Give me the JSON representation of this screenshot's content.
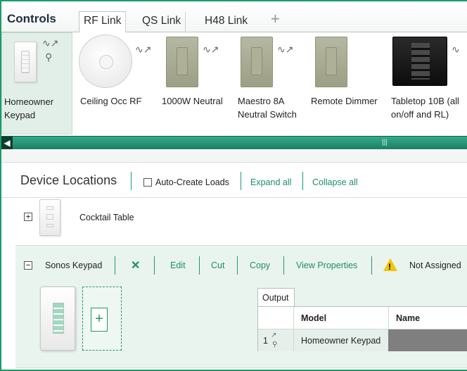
{
  "tabs": {
    "controls_label": "Controls",
    "items": [
      {
        "label": "RF Link"
      },
      {
        "label": "QS Link"
      },
      {
        "label": "H48 Link"
      }
    ],
    "add_label": "+"
  },
  "gallery": {
    "devices": [
      {
        "label": "Homeowner\nKeypad"
      },
      {
        "label": "Ceiling Occ RF"
      },
      {
        "label": "1000W Neutral"
      },
      {
        "label": "Maestro 8A\nNeutral Switch"
      },
      {
        "label": "Remote Dimmer"
      },
      {
        "label": "Tabletop 10B (all\non/off and RL)"
      }
    ]
  },
  "scrollbar": {
    "left_arrow": "◀",
    "grip": "|||"
  },
  "locations": {
    "title": "Device Locations",
    "auto_create_label": "Auto-Create Loads",
    "expand_all": "Expand all",
    "collapse_all": "Collapse all"
  },
  "cocktail": {
    "expander": "+",
    "name": "Cocktail Table"
  },
  "sonos": {
    "expander": "−",
    "name": "Sonos Keypad",
    "delete_glyph": "✕",
    "edit": "Edit",
    "cut": "Cut",
    "copy": "Copy",
    "view_properties": "View Properties",
    "warning_glyph": "!",
    "status": "Not Assigned",
    "add_glyph": "+"
  },
  "output": {
    "tab_label": "Output",
    "columns": [
      "Model",
      "Name"
    ],
    "rows": [
      {
        "index": "1",
        "model": "Homeowner Keypad",
        "name": ""
      }
    ]
  },
  "colors": {
    "accent": "#1c9b6a",
    "selected_bg": "#e2efe9",
    "group_bg": "#eaf4ef"
  }
}
